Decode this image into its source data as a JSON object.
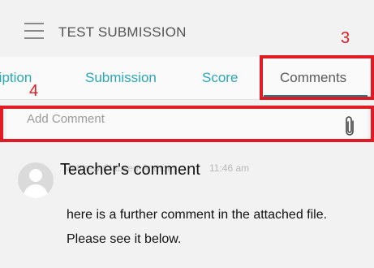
{
  "header": {
    "title": "TEST SUBMISSION",
    "menu_icon": "hamburger-menu-icon"
  },
  "annotations": {
    "comments_tab_marker": "3",
    "add_comment_marker": "4",
    "highlight_color": "#e01b24"
  },
  "tabs": [
    {
      "label": "ription",
      "active": false
    },
    {
      "label": "Submission",
      "active": false
    },
    {
      "label": "Score",
      "active": false
    },
    {
      "label": "Comments",
      "active": true
    }
  ],
  "comment_input": {
    "placeholder": "Add Comment",
    "attach_icon": "paperclip-icon"
  },
  "comment": {
    "author_partial": "Matthew Clausen-Anthony",
    "timestamp": "11:46 am",
    "heading": "Teacher's comment",
    "body": "here is a further comment in the attached file. Please see it below.",
    "avatar_icon": "default-user-avatar-icon"
  },
  "colors": {
    "tab_text": "#2aa7b8",
    "active_tab_underline": "#1e7a8c",
    "background": "#f2f2f2"
  }
}
